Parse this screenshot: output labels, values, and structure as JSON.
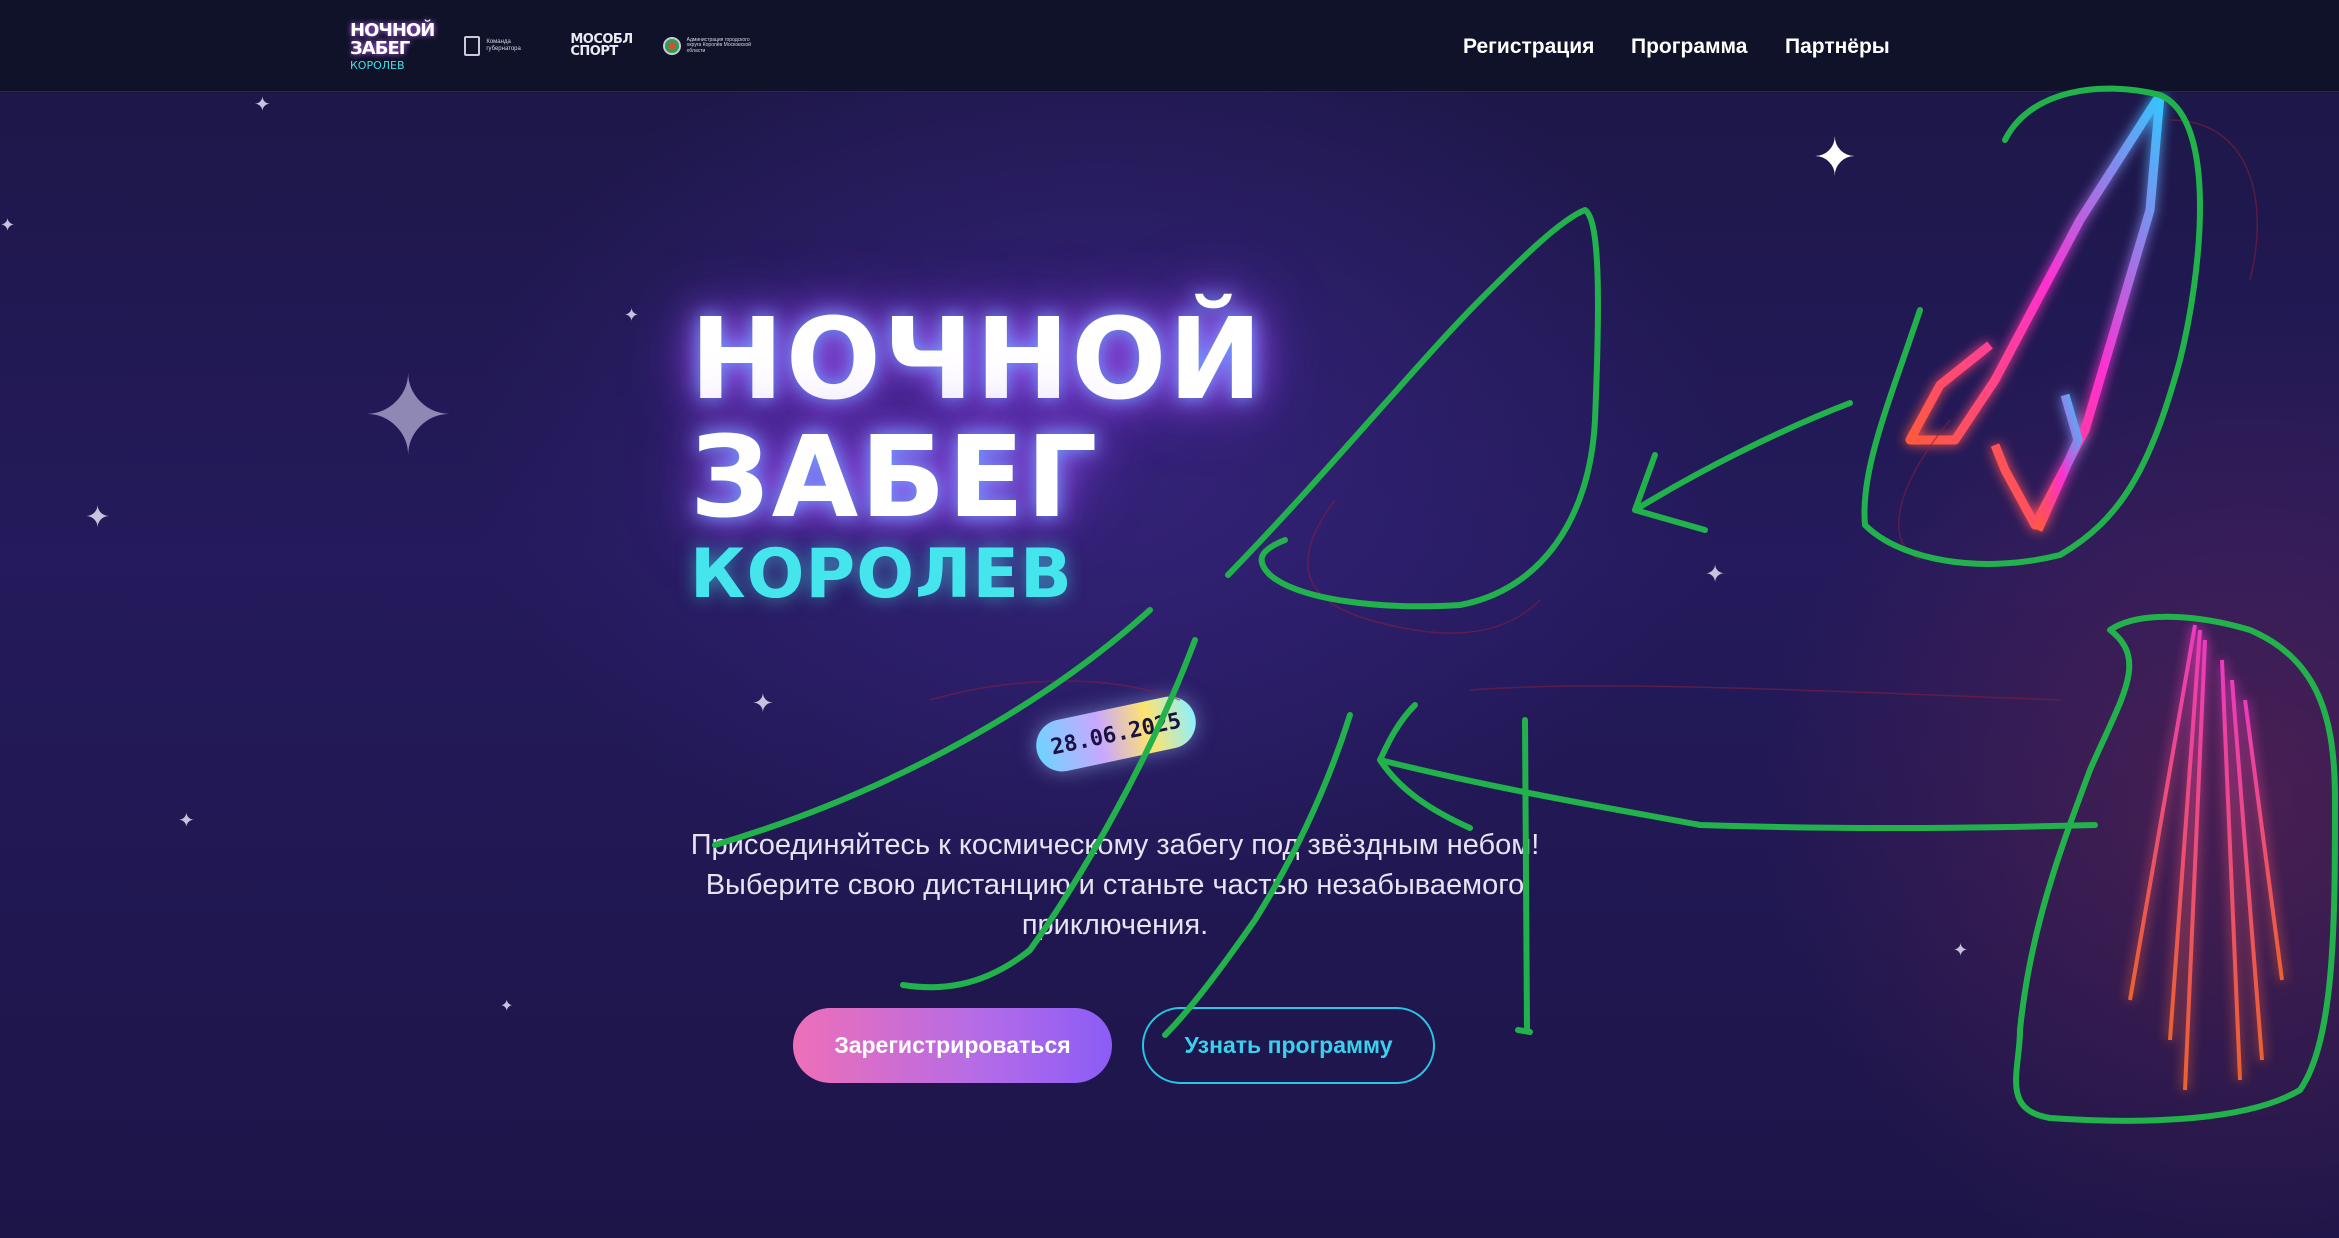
{
  "header": {
    "logo": {
      "line1": "НОЧНОЙ",
      "line2": "ЗАБЕГ",
      "line3": "КОРОЛЕВ"
    },
    "partners": [
      {
        "name": "Команда губернатора"
      },
      {
        "name_line1": "МОСОБЛ",
        "name_line2": "СПОРТ"
      },
      {
        "name": "Администрация городского округа Королёв Московской области"
      }
    ],
    "nav": [
      {
        "label": "Регистрация"
      },
      {
        "label": "Программа"
      },
      {
        "label": "Партнёры"
      }
    ]
  },
  "hero": {
    "title_line1": "НОЧНОЙ",
    "title_line2": "ЗАБЕГ",
    "title_line3": "КОРОЛЕВ",
    "date": "28.06.2025",
    "description": "Присоединяйтесь к космическому забегу под звёздным небом! Выберите свою дистанцию и станьте частью незабываемого приключения.",
    "primary_button": "Зарегистрироваться",
    "secondary_button": "Узнать программу"
  },
  "colors": {
    "header_bg": "#0f1228",
    "hero_bg": "#241a5c",
    "accent_cyan": "#45e5ee",
    "primary_gradient_start": "#ee6fb8",
    "primary_gradient_end": "#8b5cf6",
    "annotation_stroke": "#22b24c"
  },
  "icons": [
    "sparkle-star-icon",
    "rocket-icon",
    "rocket-flame-icon"
  ]
}
